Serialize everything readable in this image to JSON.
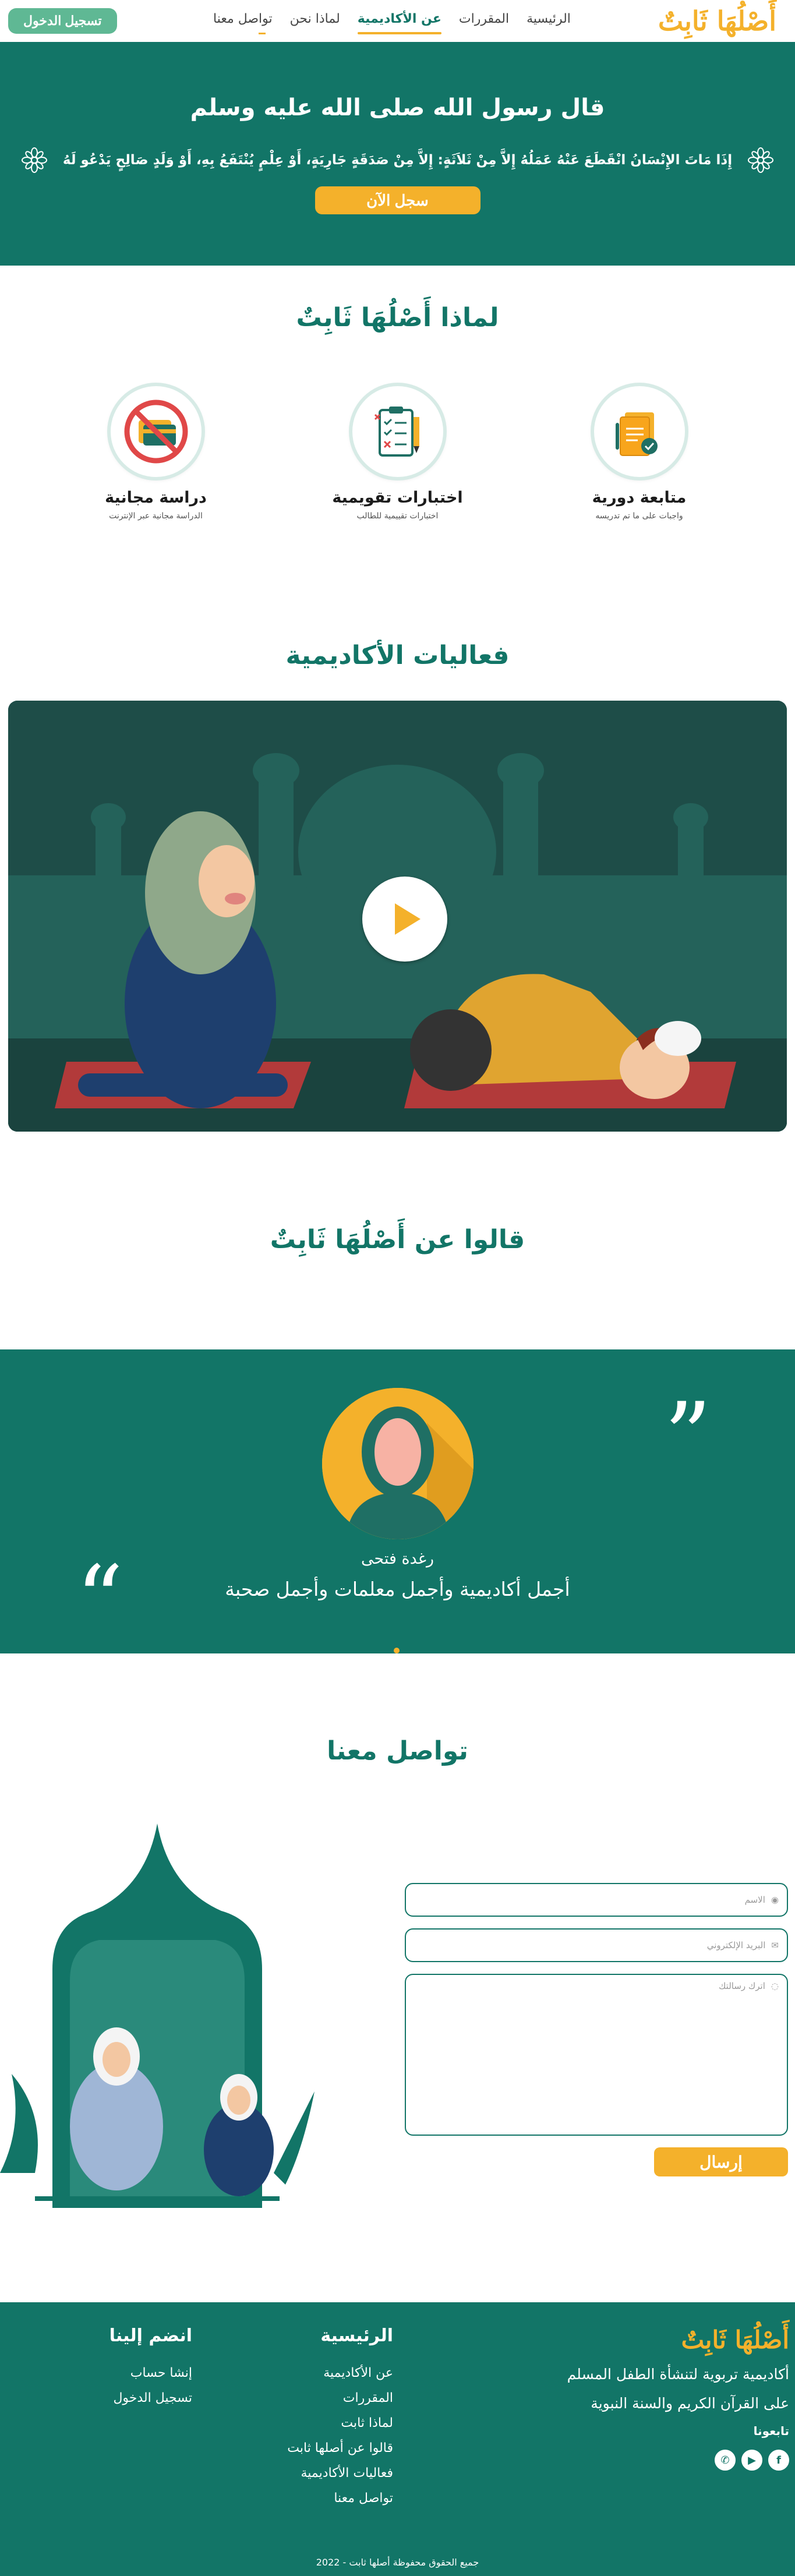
{
  "nav": {
    "logo": "أَصْلُهَا ثَابِتٌ",
    "links": [
      "الرئيسية",
      "المقررات",
      "عن الأكاديمية",
      "لماذا نحن",
      "تواصل معنا"
    ],
    "login": "تسجيل الدخول"
  },
  "hero": {
    "title": "قال رسول الله صلى الله عليه وسلم",
    "hadith": "إِذَا مَاتَ الإِنْسَانُ انْقَطَعَ عَنْهُ عَمَلُهُ إِلاَّ مِنْ ثَلاَثَةٍ: إِلاَّ مِنْ صَدَقَةٍ جَارِيَةٍ، أَوْ عِلْمٍ يُنْتَفَعُ بِهِ، أَوْ وَلَدٍ صَالِحٍ يَدْعُو لَهُ",
    "cta": "سجل الآن"
  },
  "why": {
    "title": "لماذا أَصْلُهَا ثَابِتٌ",
    "features": [
      {
        "title": "متابعة دورية",
        "desc": "واجبات على ما تم تدريسه",
        "icon": "folder-check-icon"
      },
      {
        "title": "اختبارات تقويمية",
        "desc": "اختبارات تقييمية للطالب",
        "icon": "clipboard-checklist-icon"
      },
      {
        "title": "دراسة مجانية",
        "desc": "الدراسة مجانية عبر الإنترنت",
        "icon": "no-payment-icon"
      }
    ]
  },
  "activities": {
    "title": "فعاليات الأكاديمية"
  },
  "testimonials": {
    "title": "قالوا عن أَصْلُهَا ثَابِتٌ",
    "name": "رغدة فتحى",
    "quote": "أجمل أكاديمية وأجمل معلمات وأجمل صحبة"
  },
  "contact": {
    "title": "تواصل معنا",
    "name_placeholder": "الاسم",
    "email_placeholder": "البريد الإلكتروني",
    "message_placeholder": "اترك رسالتك",
    "submit": "إرسال"
  },
  "footer": {
    "logo": "أَصْلُهَا ثَابِتٌ",
    "about_line1": "أكاديمية تربوية لتنشأة الطفل المسلم",
    "about_line2": "على القرآن الكريم والسنة النبوية",
    "follow": "تابعونا",
    "main_heading": "الرئيسية",
    "main_links": [
      "عن الأكاديمية",
      "المقررات",
      "لماذا ثابت",
      "قالوا عن أصلها ثابت",
      "فعاليات الأكاديمية",
      "تواصل معنا"
    ],
    "join_heading": "انضم إلينا",
    "join_links": [
      "إنشا حساب",
      "تسجيل الدخول"
    ],
    "copyright": "جميع الحقوق محفوظة أصلها ثابت - 2022"
  },
  "colors": {
    "primary": "#127567",
    "accent": "#f4b12b",
    "login": "#5fb894"
  }
}
